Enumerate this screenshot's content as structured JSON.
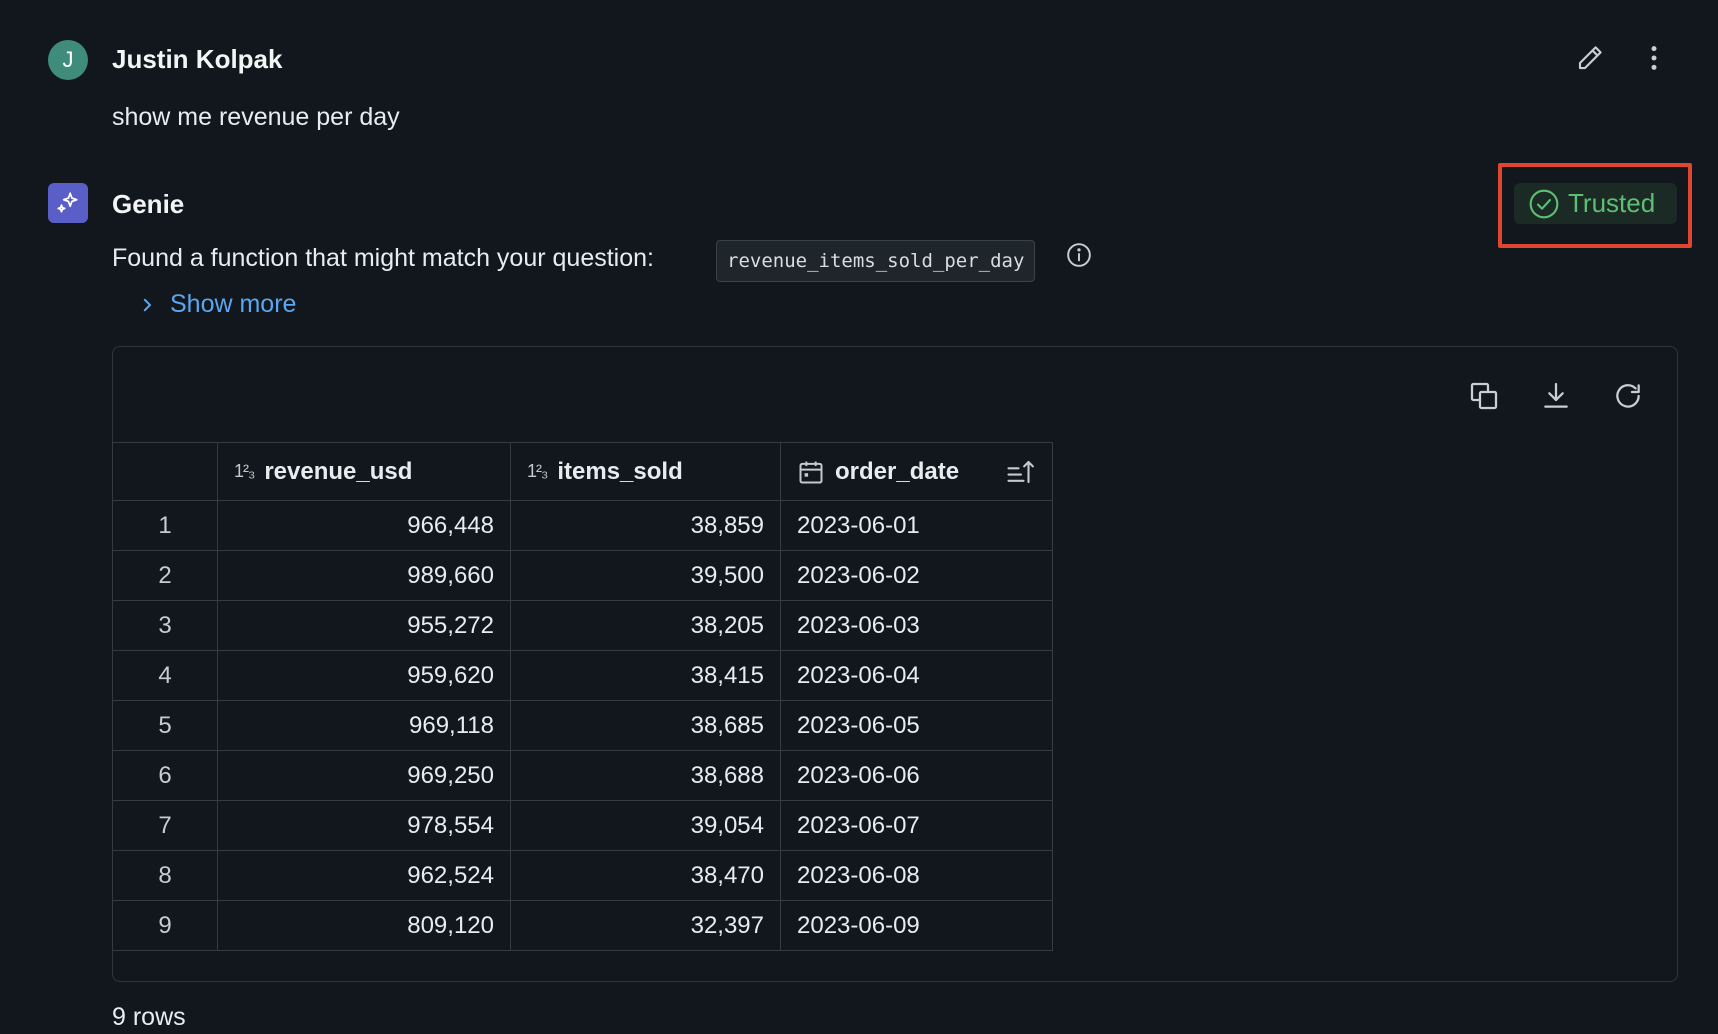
{
  "user": {
    "avatar_letter": "J",
    "name": "Justin Kolpak",
    "message": "show me revenue per day"
  },
  "genie": {
    "name": "Genie",
    "badge": "Trusted",
    "message": "Found a function that might match your question:",
    "function_name": "revenue_items_sold_per_day",
    "show_more": "Show more"
  },
  "table": {
    "columns": [
      {
        "label": "revenue_usd",
        "type": "number"
      },
      {
        "label": "items_sold",
        "type": "number"
      },
      {
        "label": "order_date",
        "type": "date"
      }
    ],
    "rows": [
      {
        "idx": "1",
        "revenue_usd": "966,448",
        "items_sold": "38,859",
        "order_date": "2023-06-01"
      },
      {
        "idx": "2",
        "revenue_usd": "989,660",
        "items_sold": "39,500",
        "order_date": "2023-06-02"
      },
      {
        "idx": "3",
        "revenue_usd": "955,272",
        "items_sold": "38,205",
        "order_date": "2023-06-03"
      },
      {
        "idx": "4",
        "revenue_usd": "959,620",
        "items_sold": "38,415",
        "order_date": "2023-06-04"
      },
      {
        "idx": "5",
        "revenue_usd": "969,118",
        "items_sold": "38,685",
        "order_date": "2023-06-05"
      },
      {
        "idx": "6",
        "revenue_usd": "969,250",
        "items_sold": "38,688",
        "order_date": "2023-06-06"
      },
      {
        "idx": "7",
        "revenue_usd": "978,554",
        "items_sold": "39,054",
        "order_date": "2023-06-07"
      },
      {
        "idx": "8",
        "revenue_usd": "962,524",
        "items_sold": "38,470",
        "order_date": "2023-06-08"
      },
      {
        "idx": "9",
        "revenue_usd": "809,120",
        "items_sold": "32,397",
        "order_date": "2023-06-09"
      }
    ],
    "row_count": "9 rows",
    "type_icon_number": "1²₃"
  },
  "icons": {
    "edit": "pencil-icon",
    "more": "kebab-menu-icon",
    "trusted": "check-circle-icon",
    "info": "info-icon",
    "copy": "copy-icon",
    "download": "download-icon",
    "refresh": "refresh-icon",
    "sort": "sort-ascending-icon",
    "calendar": "calendar-icon"
  },
  "colors": {
    "background": "#11171c",
    "trusted_green": "#5cbf73",
    "link_blue": "#5aa6f0",
    "highlight_red": "#e0452f",
    "genie_purple": "#5a5fc8",
    "user_teal": "#3f8b7c"
  }
}
